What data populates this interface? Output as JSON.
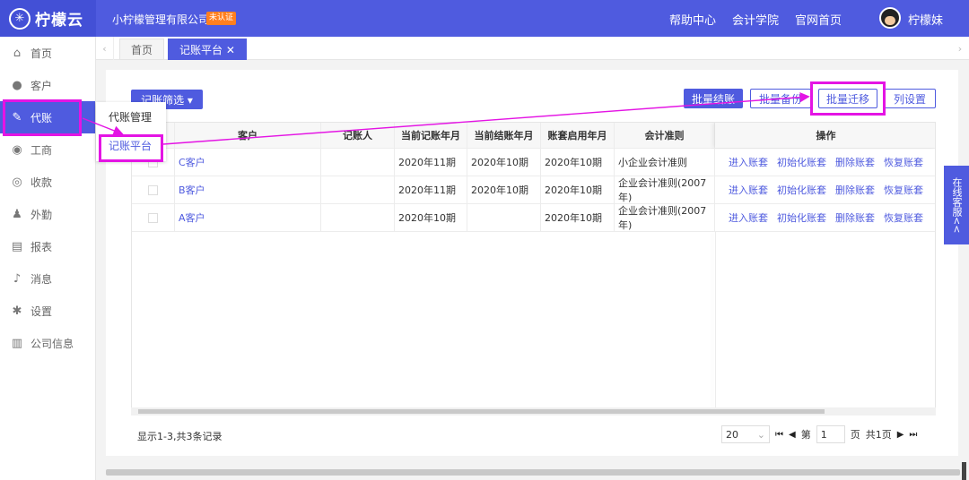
{
  "header": {
    "logo_text": "柠檬云",
    "company": "小柠檬管理有限公司",
    "badge": "未认证",
    "links": [
      "帮助中心",
      "会计学院",
      "官网首页"
    ],
    "username": "柠檬妹"
  },
  "sidebar": {
    "items": [
      {
        "label": "首页",
        "icon": "home-icon"
      },
      {
        "label": "客户",
        "icon": "users-icon"
      },
      {
        "label": "代账",
        "icon": "edit-icon"
      },
      {
        "label": "工商",
        "icon": "business-icon"
      },
      {
        "label": "收款",
        "icon": "payment-icon"
      },
      {
        "label": "外勤",
        "icon": "field-icon"
      },
      {
        "label": "报表",
        "icon": "report-icon"
      },
      {
        "label": "消息",
        "icon": "bell-icon"
      },
      {
        "label": "设置",
        "icon": "gear-icon"
      },
      {
        "label": "公司信息",
        "icon": "building-icon"
      }
    ],
    "popup": [
      "代账管理",
      "记账平台"
    ]
  },
  "tabs": [
    {
      "label": "首页"
    },
    {
      "label": "记账平台 ✕"
    }
  ],
  "toolbar": {
    "filter": "记账筛选 ▾",
    "batch_close": "批量结账",
    "batch_backup": "批量备份",
    "batch_migrate": "批量迁移",
    "column_settings": "列设置"
  },
  "table": {
    "headers": [
      "客户",
      "记账人",
      "当前记账年月",
      "当前结账年月",
      "账套启用年月",
      "会计准则",
      "操作"
    ],
    "rows": [
      {
        "customer": "C客户",
        "bookkeeper": "",
        "current": "2020年11期",
        "closed": "2020年10期",
        "start": "2020年10期",
        "standard": "小企业会计准则"
      },
      {
        "customer": "B客户",
        "bookkeeper": "",
        "current": "2020年11期",
        "closed": "2020年10期",
        "start": "2020年10期",
        "standard": "企业会计准则(2007年)"
      },
      {
        "customer": "A客户",
        "bookkeeper": "",
        "current": "2020年10期",
        "closed": "",
        "start": "2020年10期",
        "standard": "企业会计准则(2007年)"
      }
    ],
    "ops": [
      "进入账套",
      "初始化账套",
      "删除账套",
      "恢复账套"
    ]
  },
  "footer": {
    "summary": "显示1-3,共3条记录",
    "page_size": "20",
    "page_label_pre": "第",
    "page_value": "1",
    "page_label_post": "页",
    "total_pages": "共1页"
  },
  "chat": {
    "label": "在线客服<<"
  }
}
